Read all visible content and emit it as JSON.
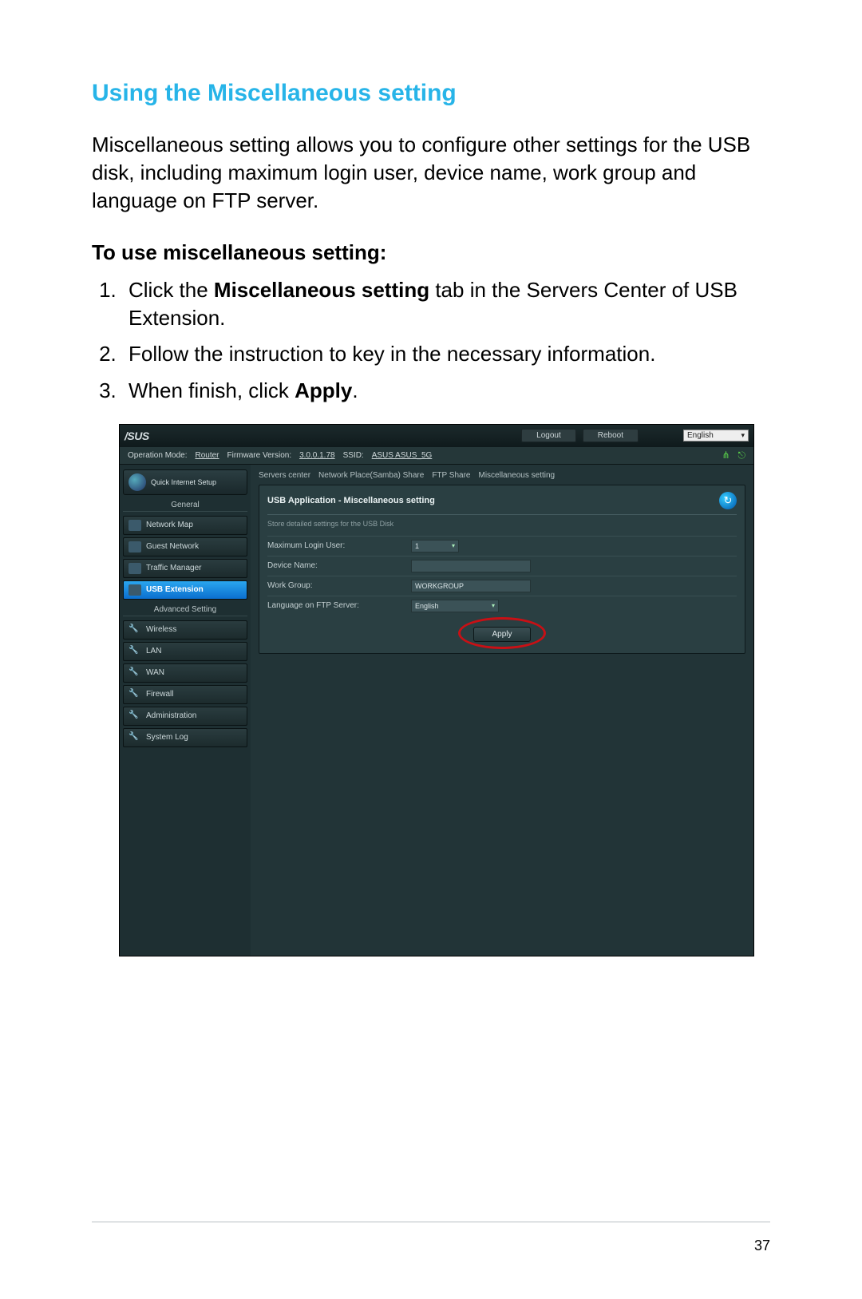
{
  "page": {
    "section_title": "Using the Miscellaneous setting",
    "intro": "Miscellaneous setting allows you to configure other settings for the USB disk, including maximum login user, device name, work group and language on FTP server.",
    "subhead": "To use miscellaneous setting:",
    "step1_a": "Click the ",
    "step1_b": "Miscellaneous setting",
    "step1_c": " tab in the Servers Center of USB Extension.",
    "step2": "Follow the instruction to key in the necessary information.",
    "step3_a": "When finish, click ",
    "step3_b": "Apply",
    "step3_c": ".",
    "page_number": "37"
  },
  "screenshot": {
    "logo": "/SUS",
    "logout": "Logout",
    "reboot": "Reboot",
    "language": "English",
    "info_opmode_label": "Operation Mode:",
    "info_opmode_value": "Router",
    "info_fw_label": "Firmware Version:",
    "info_fw_value": "3.0.0.1.78",
    "info_ssid_label": "SSID:",
    "info_ssid_value": "ASUS  ASUS_5G",
    "qis_label": "Quick Internet Setup",
    "group_general": "General",
    "group_advanced": "Advanced Setting",
    "nav_general": [
      "Network Map",
      "Guest Network",
      "Traffic Manager",
      "USB Extension"
    ],
    "nav_advanced": [
      "Wireless",
      "LAN",
      "WAN",
      "Firewall",
      "Administration",
      "System Log"
    ],
    "tabs": [
      "Servers center",
      "Network Place(Samba) Share",
      "FTP Share",
      "Miscellaneous setting"
    ],
    "panel_title": "USB Application - Miscellaneous setting",
    "panel_sub": "Store detailed settings for the USB Disk",
    "row_max_login": "Maximum Login User:",
    "row_max_login_val": "1",
    "row_device_name": "Device Name:",
    "row_device_name_val": "",
    "row_work_group": "Work Group:",
    "row_work_group_val": "WORKGROUP",
    "row_ftp_lang": "Language on FTP Server:",
    "row_ftp_lang_val": "English",
    "apply": "Apply"
  }
}
